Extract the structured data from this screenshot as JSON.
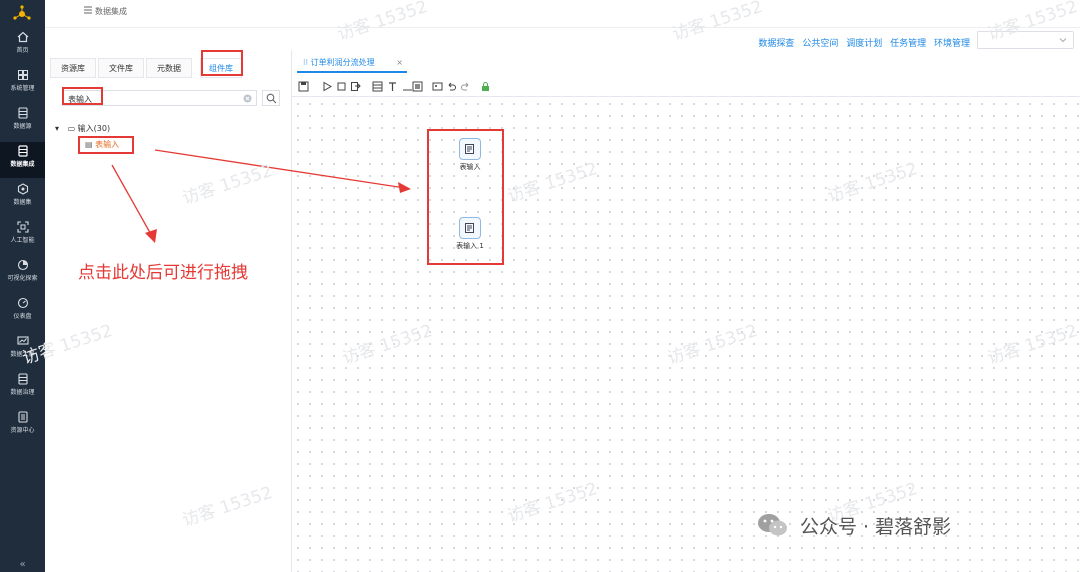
{
  "breadcrumb": "数据集成",
  "nav": {
    "items": [
      {
        "label": "首页",
        "icon": "home-icon"
      },
      {
        "label": "系统管理",
        "icon": "grid-icon"
      },
      {
        "label": "数据源",
        "icon": "database-icon"
      },
      {
        "label": "数据集成",
        "icon": "integration-icon"
      },
      {
        "label": "数据集",
        "icon": "dataset-icon"
      },
      {
        "label": "人工智能",
        "icon": "ai-icon"
      },
      {
        "label": "可视化探索",
        "icon": "pie-icon"
      },
      {
        "label": "仪表盘",
        "icon": "gauge-icon"
      },
      {
        "label": "数据大屏",
        "icon": "screen-icon"
      },
      {
        "label": "数据治理",
        "icon": "governance-icon"
      },
      {
        "label": "资源中心",
        "icon": "resource-icon"
      }
    ],
    "active": "数据集成",
    "collapse_label": "«"
  },
  "topmenu": [
    "数据探查",
    "公共空间",
    "调度计划",
    "任务管理",
    "环境管理"
  ],
  "panel": {
    "tabs": [
      "资源库",
      "文件库",
      "元数据",
      "组件库"
    ],
    "active_tab": "组件库",
    "search_value": "表输入",
    "tree_root": "输入(30)",
    "tree_child": "表输入"
  },
  "editor": {
    "tab_label": "订单利润分流处理",
    "close": "×"
  },
  "nodes": [
    {
      "label": "表输入"
    },
    {
      "label": "表输入 1"
    }
  ],
  "annotation": "点击此处后可进行拖拽",
  "watermark": "访客 15352",
  "footer_brand": "公众号 · 碧落舒影",
  "colors": {
    "accent": "#1e88e5",
    "highlight": "#e53935",
    "nav_bg": "#1f2d3d"
  }
}
